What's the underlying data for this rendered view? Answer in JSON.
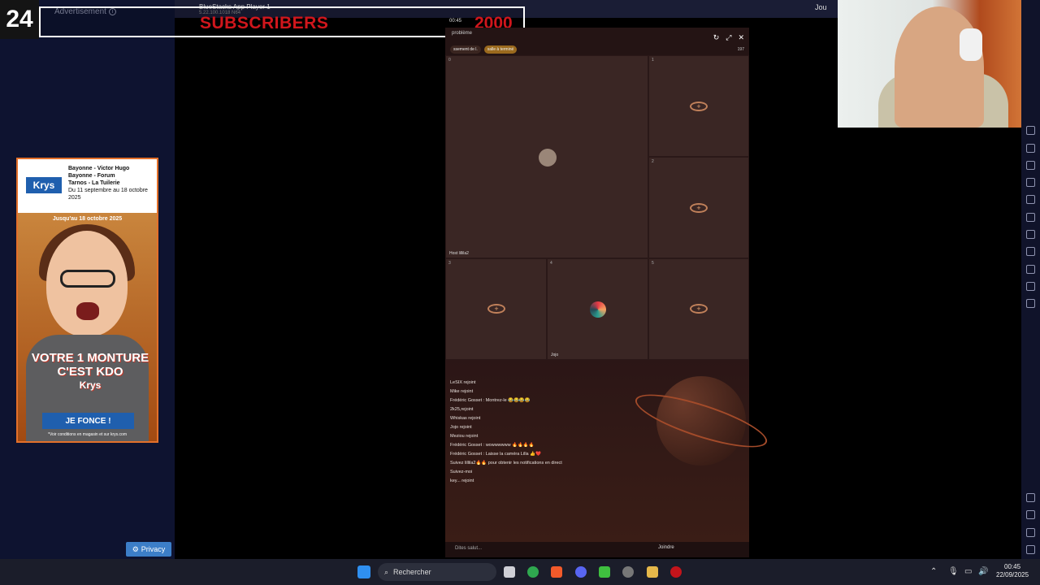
{
  "counter": "24",
  "advertisement": {
    "label": "Advertisement",
    "info_icon": "info-icon"
  },
  "ad": {
    "logo": "Krys",
    "lines": [
      "Bayonne - Victor Hugo",
      "Bayonne - Forum",
      "Tarnos - La Tuilerie"
    ],
    "dates": "Du 11 septembre au 18 octobre 2025",
    "jusquau": "Jusqu'au 18 octobre 2025",
    "slogan_line1": "VOTRE 1",
    "slogan_line2": "MONTURE",
    "slogan_line3": "C'EST KDO",
    "brand": "Krys",
    "button": "JE FONCE !",
    "footer": "*Voir conditions en magasin et sur krys.com"
  },
  "privacy": "Privacy",
  "subscribers": {
    "label": "SUBSCRIBERS",
    "count": "2000",
    "time": "00:45"
  },
  "app": {
    "title": "BlueStacks App Player 1",
    "subtitle": "5.22.100.1018 N64",
    "join": "Jou"
  },
  "phone": {
    "user": "problème",
    "tabs": [
      "ssement de l.",
      "salle à terminé"
    ],
    "count": "197",
    "host": "lillila2",
    "seat2_name": "Jojo",
    "cells": [
      "0",
      "1",
      "2",
      "3",
      "4",
      "5"
    ],
    "chat": [
      "LeSIX rejoint",
      "Mike rejoint",
      "Frédéric Gosset : Montrez-le 😂😂😂😂",
      "2k25,rejoint",
      "Whiskas rejoint",
      "Jojo rejoint",
      "Meziou rejoint",
      "Frédéric Gosset : wowwwwww 🔥🔥🔥🔥",
      "Frédéric Gosset : Laisse la caméra Lilla 👍❤️",
      "Suivez lillila2🔥🔥 pour obtenir les notifications en direct",
      "Suivez-moi",
      "key... rejoint"
    ],
    "say_placeholder": "Dites salut...",
    "join_label": "Joindre"
  },
  "taskbar": {
    "search": "Rechercher",
    "time": "00:45",
    "date": "22/09/2025"
  }
}
